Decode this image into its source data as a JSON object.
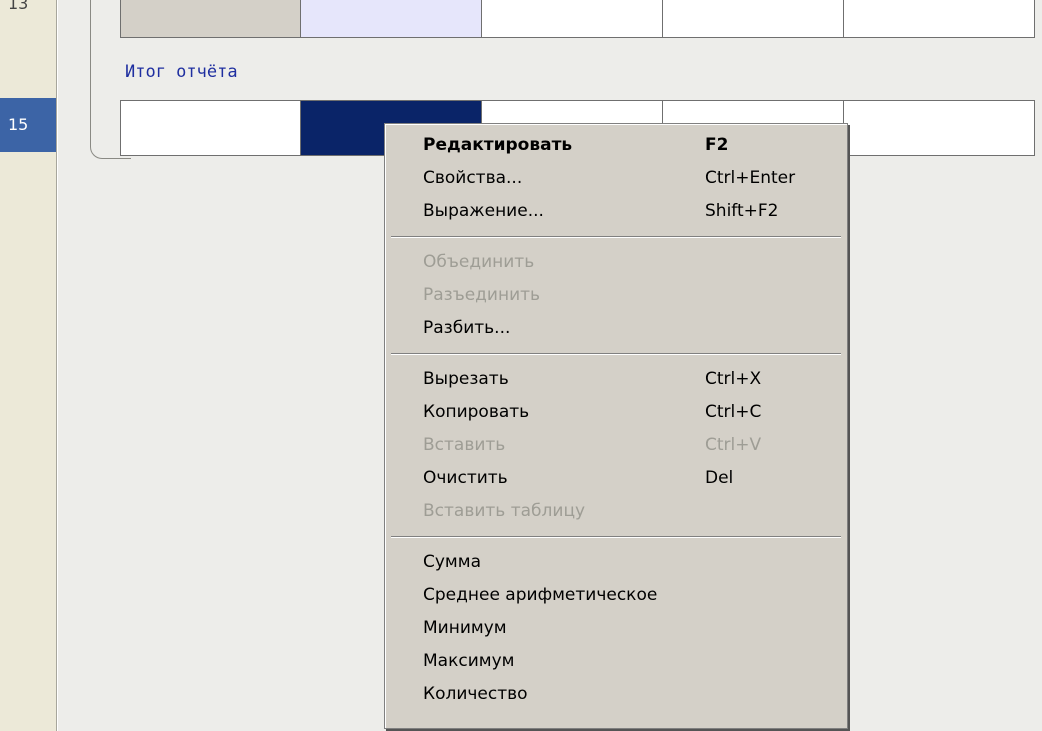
{
  "row_numbers": {
    "top": "13",
    "selected": "15"
  },
  "band": {
    "label": "Итог отчёта"
  },
  "context_menu": {
    "group1": [
      {
        "label": "Редактировать",
        "shortcut": "F2",
        "enabled": true,
        "bold": true
      },
      {
        "label": "Свойства...",
        "shortcut": "Ctrl+Enter",
        "enabled": true
      },
      {
        "label": "Выражение...",
        "shortcut": "Shift+F2",
        "enabled": true
      }
    ],
    "group2": [
      {
        "label": "Объединить",
        "shortcut": "",
        "enabled": false
      },
      {
        "label": "Разъединить",
        "shortcut": "",
        "enabled": false
      },
      {
        "label": "Разбить...",
        "shortcut": "",
        "enabled": true
      }
    ],
    "group3": [
      {
        "label": "Вырезать",
        "shortcut": "Ctrl+X",
        "enabled": true
      },
      {
        "label": "Копировать",
        "shortcut": "Ctrl+C",
        "enabled": true
      },
      {
        "label": "Вставить",
        "shortcut": "Ctrl+V",
        "enabled": false
      },
      {
        "label": "Очистить",
        "shortcut": "Del",
        "enabled": true
      },
      {
        "label": "Вставить таблицу",
        "shortcut": "",
        "enabled": false
      }
    ],
    "group4": [
      {
        "label": "Сумма",
        "shortcut": "",
        "enabled": true
      },
      {
        "label": "Среднее арифметическое",
        "shortcut": "",
        "enabled": true
      },
      {
        "label": "Минимум",
        "shortcut": "",
        "enabled": true
      },
      {
        "label": "Максимум",
        "shortcut": "",
        "enabled": true
      },
      {
        "label": "Количество",
        "shortcut": "",
        "enabled": true
      }
    ]
  },
  "colors": {
    "selected_cell": "#0a2468",
    "row_highlight": "#3c64a6",
    "band_label": "#1f2fa0"
  }
}
